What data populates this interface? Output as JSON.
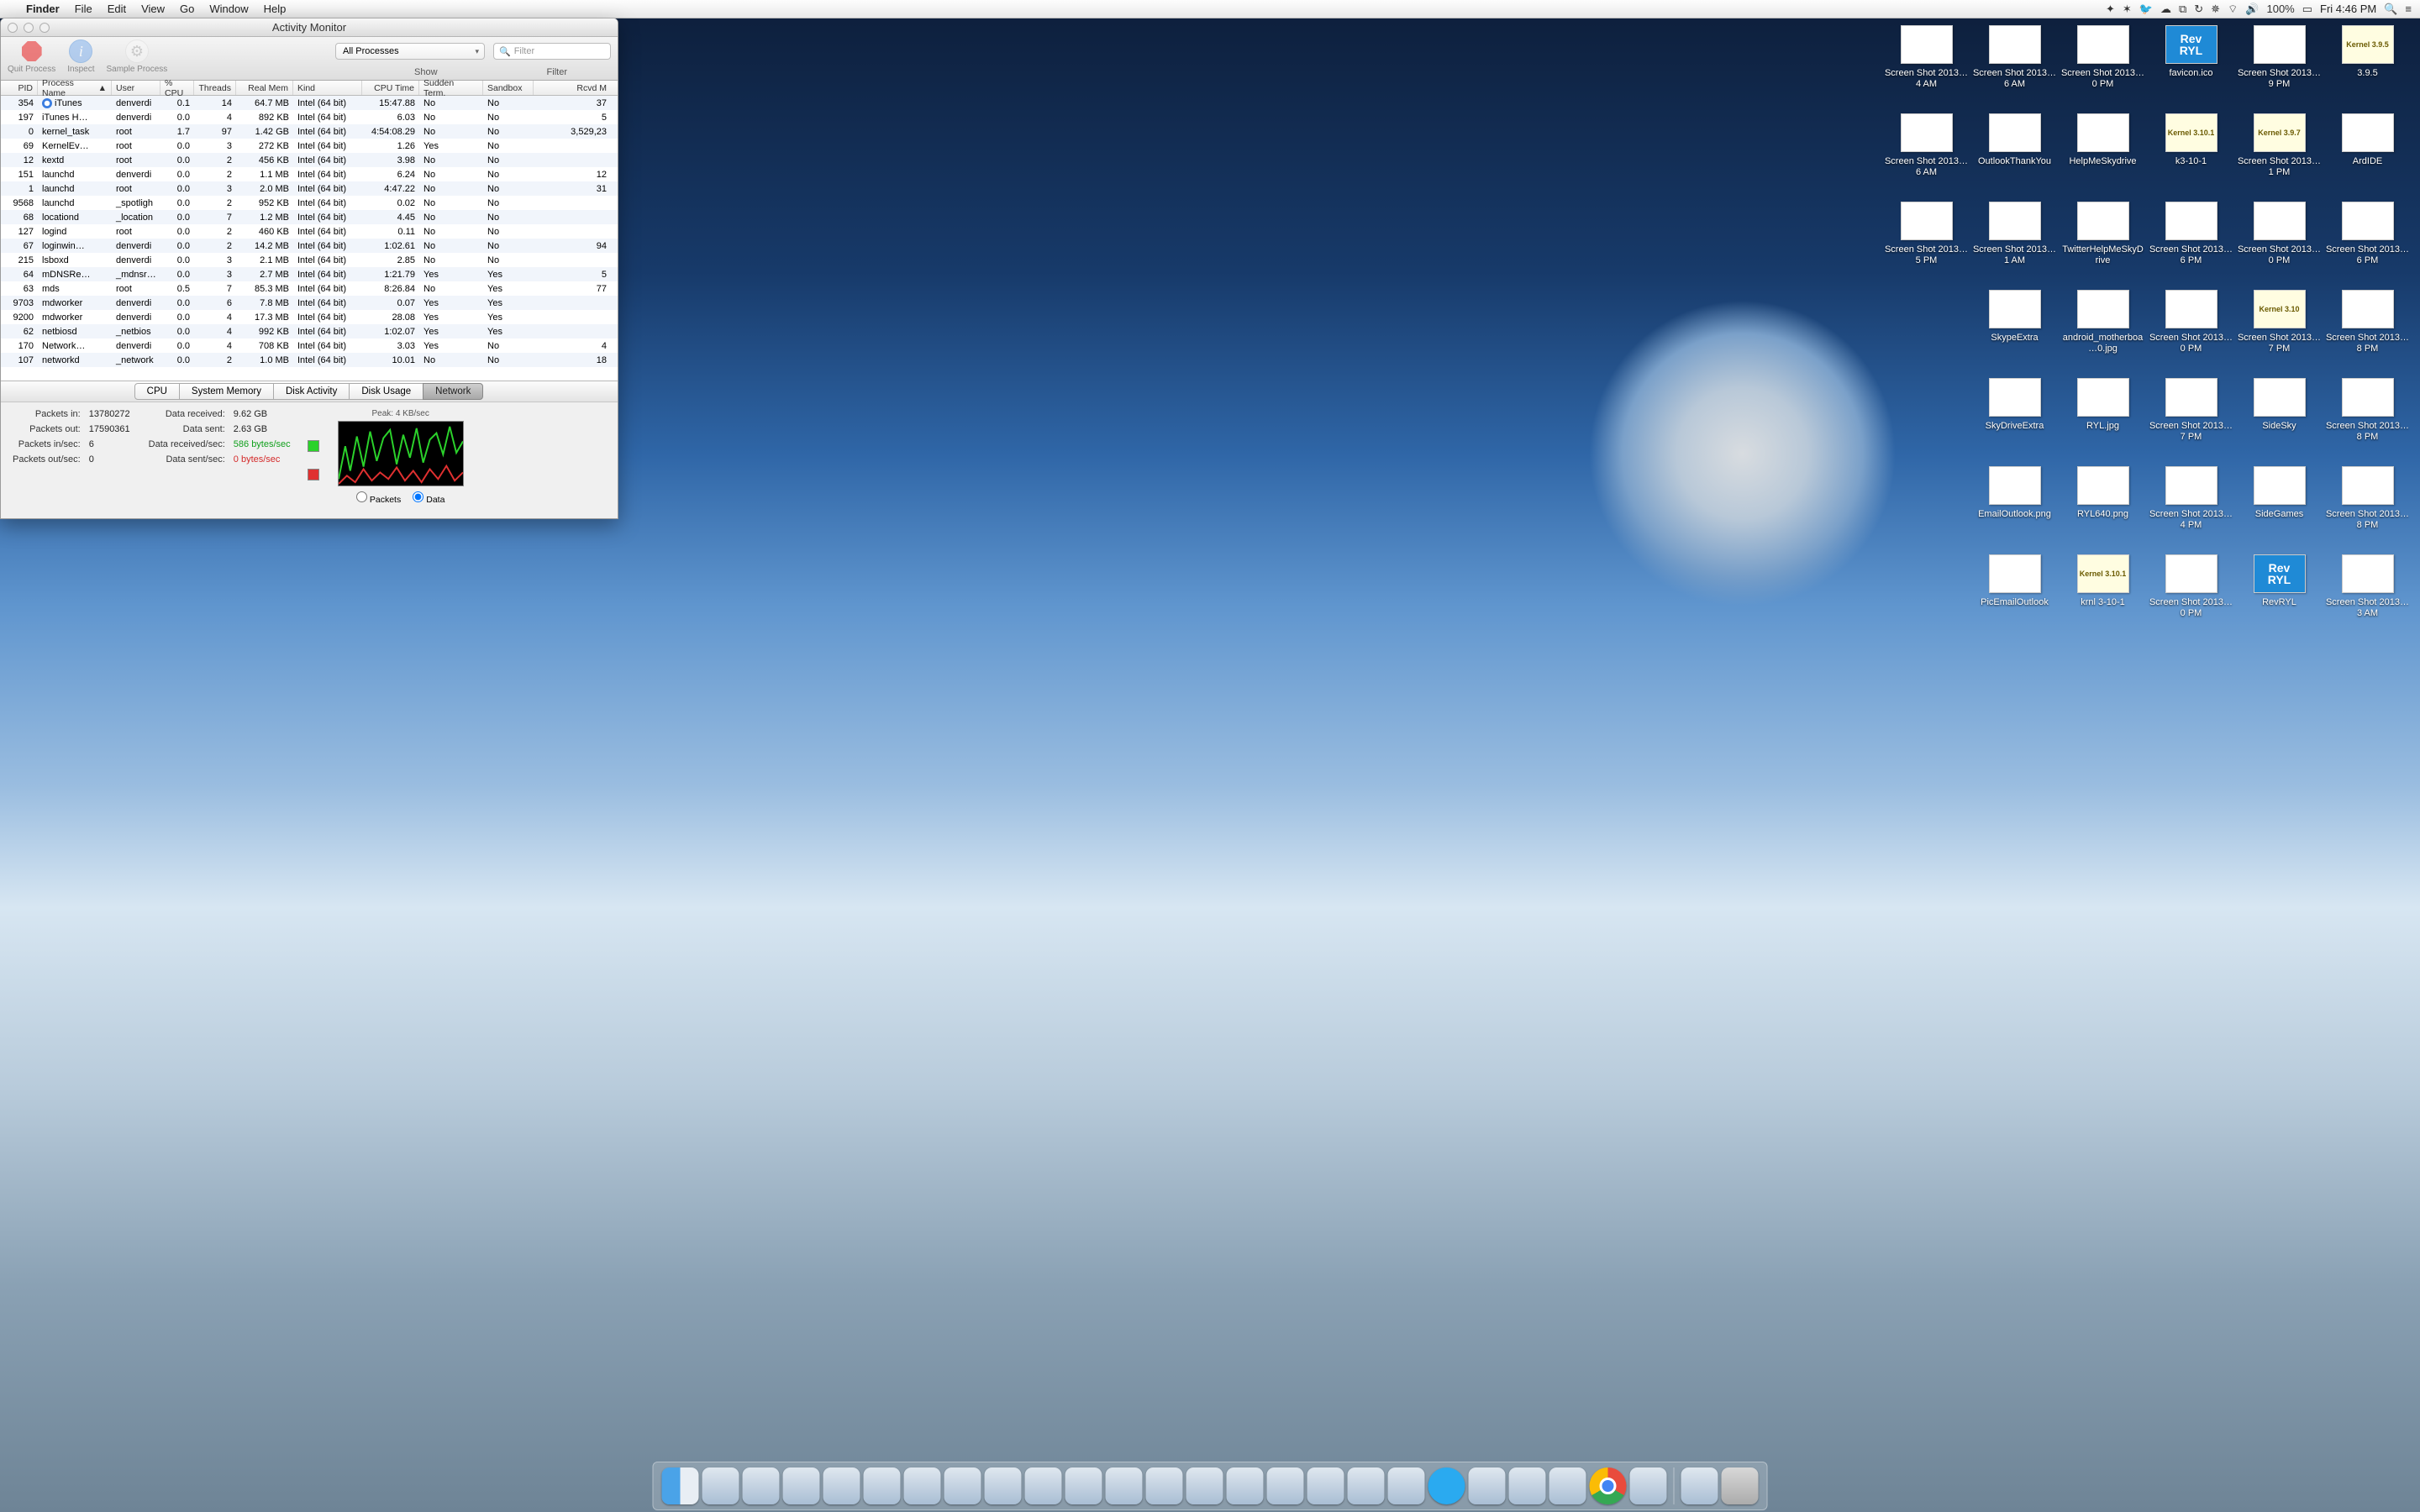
{
  "menubar": {
    "app": "Finder",
    "items": [
      "File",
      "Edit",
      "View",
      "Go",
      "Window",
      "Help"
    ],
    "battery": "100%",
    "clock": "Fri 4:46 PM"
  },
  "window": {
    "title": "Activity Monitor",
    "toolbar": {
      "quit": "Quit Process",
      "inspect": "Inspect",
      "sample": "Sample Process",
      "dropdownValue": "All Processes",
      "filterPlaceholder": "Filter",
      "showLabel": "Show",
      "filterLabel": "Filter"
    },
    "columns": [
      "PID",
      "Process Name",
      "User",
      "% CPU",
      "Threads",
      "Real Mem",
      "Kind",
      "CPU Time",
      "Sudden Term.",
      "Sandbox",
      "Rcvd M"
    ],
    "rows": [
      {
        "pid": "354",
        "name": "iTunes",
        "user": "denverdi",
        "cpu": "0.1",
        "thr": "14",
        "mem": "64.7 MB",
        "kind": "Intel (64 bit)",
        "time": "15:47.88",
        "sud": "No",
        "sand": "No",
        "rcv": "37",
        "icon": "itunes"
      },
      {
        "pid": "197",
        "name": "iTunes H…",
        "user": "denverdi",
        "cpu": "0.0",
        "thr": "4",
        "mem": "892 KB",
        "kind": "Intel (64 bit)",
        "time": "6.03",
        "sud": "No",
        "sand": "No",
        "rcv": "5"
      },
      {
        "pid": "0",
        "name": "kernel_task",
        "user": "root",
        "cpu": "1.7",
        "thr": "97",
        "mem": "1.42 GB",
        "kind": "Intel (64 bit)",
        "time": "4:54:08.29",
        "sud": "No",
        "sand": "No",
        "rcv": "3,529,23"
      },
      {
        "pid": "69",
        "name": "KernelEv…",
        "user": "root",
        "cpu": "0.0",
        "thr": "3",
        "mem": "272 KB",
        "kind": "Intel (64 bit)",
        "time": "1.26",
        "sud": "Yes",
        "sand": "No",
        "rcv": ""
      },
      {
        "pid": "12",
        "name": "kextd",
        "user": "root",
        "cpu": "0.0",
        "thr": "2",
        "mem": "456 KB",
        "kind": "Intel (64 bit)",
        "time": "3.98",
        "sud": "No",
        "sand": "No",
        "rcv": ""
      },
      {
        "pid": "151",
        "name": "launchd",
        "user": "denverdi",
        "cpu": "0.0",
        "thr": "2",
        "mem": "1.1 MB",
        "kind": "Intel (64 bit)",
        "time": "6.24",
        "sud": "No",
        "sand": "No",
        "rcv": "12"
      },
      {
        "pid": "1",
        "name": "launchd",
        "user": "root",
        "cpu": "0.0",
        "thr": "3",
        "mem": "2.0 MB",
        "kind": "Intel (64 bit)",
        "time": "4:47.22",
        "sud": "No",
        "sand": "No",
        "rcv": "31"
      },
      {
        "pid": "9568",
        "name": "launchd",
        "user": "_spotligh",
        "cpu": "0.0",
        "thr": "2",
        "mem": "952 KB",
        "kind": "Intel (64 bit)",
        "time": "0.02",
        "sud": "No",
        "sand": "No",
        "rcv": ""
      },
      {
        "pid": "68",
        "name": "locationd",
        "user": "_location",
        "cpu": "0.0",
        "thr": "7",
        "mem": "1.2 MB",
        "kind": "Intel (64 bit)",
        "time": "4.45",
        "sud": "No",
        "sand": "No",
        "rcv": ""
      },
      {
        "pid": "127",
        "name": "logind",
        "user": "root",
        "cpu": "0.0",
        "thr": "2",
        "mem": "460 KB",
        "kind": "Intel (64 bit)",
        "time": "0.11",
        "sud": "No",
        "sand": "No",
        "rcv": ""
      },
      {
        "pid": "67",
        "name": "loginwin…",
        "user": "denverdi",
        "cpu": "0.0",
        "thr": "2",
        "mem": "14.2 MB",
        "kind": "Intel (64 bit)",
        "time": "1:02.61",
        "sud": "No",
        "sand": "No",
        "rcv": "94"
      },
      {
        "pid": "215",
        "name": "lsboxd",
        "user": "denverdi",
        "cpu": "0.0",
        "thr": "3",
        "mem": "2.1 MB",
        "kind": "Intel (64 bit)",
        "time": "2.85",
        "sud": "No",
        "sand": "No",
        "rcv": ""
      },
      {
        "pid": "64",
        "name": "mDNSRe…",
        "user": "_mdnsres",
        "cpu": "0.0",
        "thr": "3",
        "mem": "2.7 MB",
        "kind": "Intel (64 bit)",
        "time": "1:21.79",
        "sud": "Yes",
        "sand": "Yes",
        "rcv": "5"
      },
      {
        "pid": "63",
        "name": "mds",
        "user": "root",
        "cpu": "0.5",
        "thr": "7",
        "mem": "85.3 MB",
        "kind": "Intel (64 bit)",
        "time": "8:26.84",
        "sud": "No",
        "sand": "Yes",
        "rcv": "77"
      },
      {
        "pid": "9703",
        "name": "mdworker",
        "user": "denverdi",
        "cpu": "0.0",
        "thr": "6",
        "mem": "7.8 MB",
        "kind": "Intel (64 bit)",
        "time": "0.07",
        "sud": "Yes",
        "sand": "Yes",
        "rcv": ""
      },
      {
        "pid": "9200",
        "name": "mdworker",
        "user": "denverdi",
        "cpu": "0.0",
        "thr": "4",
        "mem": "17.3 MB",
        "kind": "Intel (64 bit)",
        "time": "28.08",
        "sud": "Yes",
        "sand": "Yes",
        "rcv": ""
      },
      {
        "pid": "62",
        "name": "netbiosd",
        "user": "_netbios",
        "cpu": "0.0",
        "thr": "4",
        "mem": "992 KB",
        "kind": "Intel (64 bit)",
        "time": "1:02.07",
        "sud": "Yes",
        "sand": "Yes",
        "rcv": ""
      },
      {
        "pid": "170",
        "name": "Network…",
        "user": "denverdi",
        "cpu": "0.0",
        "thr": "4",
        "mem": "708 KB",
        "kind": "Intel (64 bit)",
        "time": "3.03",
        "sud": "Yes",
        "sand": "No",
        "rcv": "4"
      },
      {
        "pid": "107",
        "name": "networkd",
        "user": "_network",
        "cpu": "0.0",
        "thr": "2",
        "mem": "1.0 MB",
        "kind": "Intel (64 bit)",
        "time": "10.01",
        "sud": "No",
        "sand": "No",
        "rcv": "18"
      }
    ],
    "tabs": [
      "CPU",
      "System Memory",
      "Disk Activity",
      "Disk Usage",
      "Network"
    ],
    "activeTab": 4,
    "net": {
      "peak": "Peak: 4 KB/sec",
      "labels": {
        "pin": "Packets in:",
        "pout": "Packets out:",
        "pinsec": "Packets in/sec:",
        "poutsec": "Packets out/sec:",
        "drec": "Data received:",
        "dsent": "Data sent:",
        "drecsec": "Data received/sec:",
        "dsentsec": "Data sent/sec:"
      },
      "vals": {
        "pin": "13780272",
        "pout": "17590361",
        "pinsec": "6",
        "poutsec": "0",
        "drec": "9.62 GB",
        "dsent": "2.63 GB",
        "drecsec": "586 bytes/sec",
        "dsentsec": "0 bytes/sec"
      },
      "radioPackets": "Packets",
      "radioData": "Data"
    }
  },
  "desktopIcons": [
    {
      "name": "Screen Shot 2013…4 AM",
      "t": "img"
    },
    {
      "name": "Screen Shot 2013…6 AM",
      "t": "img"
    },
    {
      "name": "Screen Shot 2013…0 PM",
      "t": "img"
    },
    {
      "name": "favicon.ico",
      "t": "blue",
      "txt": "Rev RYL"
    },
    {
      "name": "Screen Shot 2013…9 PM",
      "t": "img"
    },
    {
      "name": "3.9.5",
      "t": "lbl",
      "txt": "Kernel 3.9.5"
    },
    {
      "name": "Screen Shot 2013…6 AM",
      "t": "img"
    },
    {
      "name": "OutlookThankYou",
      "t": "img"
    },
    {
      "name": "HelpMeSkydrive",
      "t": "img"
    },
    {
      "name": "k3-10-1",
      "t": "lbl",
      "txt": "Kernel 3.10.1"
    },
    {
      "name": "Screen Shot 2013…1 PM",
      "t": "lbl",
      "txt": "Kernel 3.9.7"
    },
    {
      "name": "ArdIDE",
      "t": "img"
    },
    {
      "name": "Screen Shot 2013…5 PM",
      "t": "img"
    },
    {
      "name": "Screen Shot 2013…1 AM",
      "t": "img"
    },
    {
      "name": "TwitterHelpMeSkyDrive",
      "t": "img"
    },
    {
      "name": "Screen Shot 2013…6 PM",
      "t": "img"
    },
    {
      "name": "Screen Shot 2013…0 PM",
      "t": "img"
    },
    {
      "name": "Screen Shot 2013…6 PM",
      "t": "img"
    },
    {
      "name": "",
      "t": "none"
    },
    {
      "name": "SkypeExtra",
      "t": "img"
    },
    {
      "name": "android_motherboa…0.jpg",
      "t": "img"
    },
    {
      "name": "Screen Shot 2013…0 PM",
      "t": "img"
    },
    {
      "name": "Screen Shot 2013…7 PM",
      "t": "lbl",
      "txt": "Kernel 3.10"
    },
    {
      "name": "Screen Shot 2013…8 PM",
      "t": "img"
    },
    {
      "name": "",
      "t": "none"
    },
    {
      "name": "SkyDriveExtra",
      "t": "img"
    },
    {
      "name": "RYL.jpg",
      "t": "img"
    },
    {
      "name": "Screen Shot 2013…7 PM",
      "t": "img"
    },
    {
      "name": "SideSky",
      "t": "img"
    },
    {
      "name": "Screen Shot 2013…8 PM",
      "t": "img"
    },
    {
      "name": "",
      "t": "none"
    },
    {
      "name": "EmailOutlook.png",
      "t": "img"
    },
    {
      "name": "RYL640.png",
      "t": "img"
    },
    {
      "name": "Screen Shot 2013…4 PM",
      "t": "img"
    },
    {
      "name": "SideGames",
      "t": "img"
    },
    {
      "name": "Screen Shot 2013…8 PM",
      "t": "img"
    },
    {
      "name": "",
      "t": "none"
    },
    {
      "name": "PicEmailOutlook",
      "t": "img"
    },
    {
      "name": "krnl 3-10-1",
      "t": "lbl",
      "txt": "Kernel 3.10.1"
    },
    {
      "name": "Screen Shot 2013…0 PM",
      "t": "img"
    },
    {
      "name": "RevRYL",
      "t": "blue",
      "txt": "Rev RYL"
    },
    {
      "name": "Screen Shot 2013…3 AM",
      "t": "img"
    }
  ],
  "dock": [
    "finder",
    "launchpad",
    "missioncontrol",
    "dashboard",
    "safari",
    "mail",
    "contacts",
    "calendar",
    "reminders",
    "messages",
    "facetime",
    "notes",
    "maps",
    "photobooth",
    "preview",
    "appstore",
    "itunes",
    "ibooks",
    "settings",
    "skype",
    "utorrent",
    "twitter",
    "activitymonitor",
    "chrome",
    "vlc"
  ]
}
